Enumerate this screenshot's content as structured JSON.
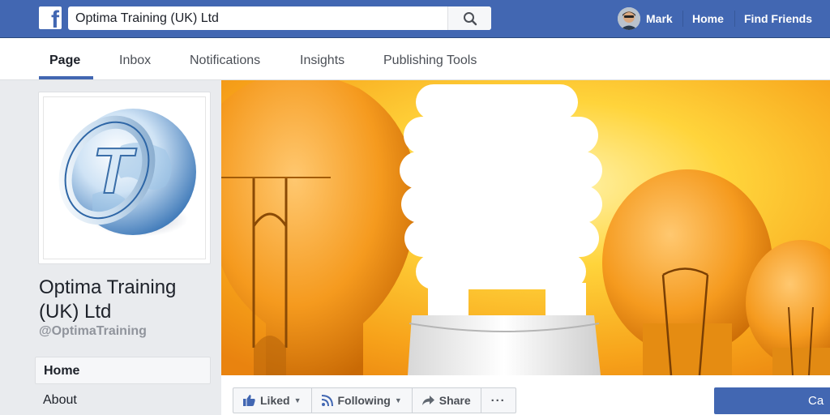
{
  "topbar": {
    "logo_letter": "f",
    "search_value": "Optima Training (UK) Ltd",
    "user_name": "Mark",
    "nav_home": "Home",
    "nav_find_friends": "Find Friends"
  },
  "tabs": [
    {
      "label": "Page",
      "active": true
    },
    {
      "label": "Inbox"
    },
    {
      "label": "Notifications"
    },
    {
      "label": "Insights"
    },
    {
      "label": "Publishing Tools"
    }
  ],
  "profile": {
    "name": "Optima Training (UK) Ltd",
    "handle": "@OptimaTraining",
    "logo_letter": "T"
  },
  "left_nav": [
    {
      "label": "Home",
      "active": true
    },
    {
      "label": "About"
    }
  ],
  "actions": {
    "liked": "Liked",
    "following": "Following",
    "share": "Share",
    "more": "···",
    "cta_partial": "Ca"
  },
  "colors": {
    "brand_blue": "#4267b2",
    "cover_orange": "#f29a14"
  }
}
